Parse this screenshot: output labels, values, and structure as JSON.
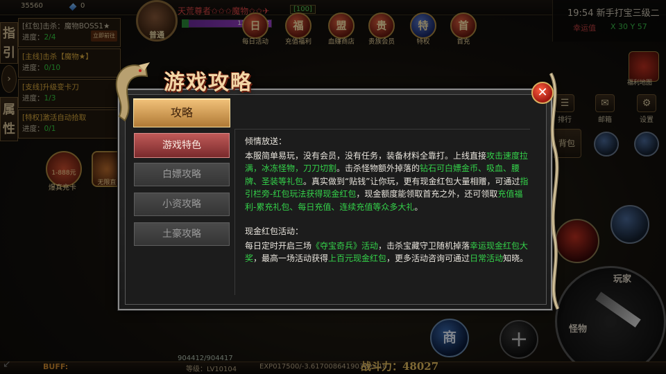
{
  "hud": {
    "gold": "35560",
    "gems": "0",
    "side_tabs": [
      "指",
      "引",
      "属",
      "性"
    ],
    "quests": [
      {
        "title": "[红包]击杀：魔物BOSS1★",
        "progress_label": "进度：",
        "progress": "2/4",
        "button": "立即前往"
      },
      {
        "title": "[主线]击杀【魔物★】",
        "progress_label": "进度：",
        "progress": "0/10"
      },
      {
        "title": "[支线]升级变卡刀",
        "progress_label": "进度：",
        "progress": "1/3"
      },
      {
        "title": "[特权]激活自动拾取",
        "progress_label": "进度：",
        "progress": "0/1"
      }
    ],
    "avatar_label": "普通",
    "player_name": "天荒尊者✩✩✩魔物✩✩✈",
    "player_level": "[100]",
    "hp_text": "12131853",
    "top_icons": [
      {
        "glyph": "日",
        "label": "每日活动"
      },
      {
        "glyph": "福",
        "label": "充值福利"
      },
      {
        "glyph": "盟",
        "label": "血赚商店"
      },
      {
        "glyph": "贵",
        "label": "贵族会员"
      },
      {
        "glyph": "特",
        "label": "特权"
      },
      {
        "glyph": "首",
        "label": "首充"
      }
    ],
    "clock": "19:54 新手打宝三级二",
    "clock_sub": "幸运值",
    "clock_coords": "X 30  Y 57",
    "right_icons": [
      {
        "glyph": "☰",
        "label": "排行"
      },
      {
        "glyph": "✉",
        "label": "邮箱"
      },
      {
        "glyph": "⚙",
        "label": "设置"
      }
    ],
    "right_extra": "福利地图",
    "bag_label": "背包",
    "left_item_1": "1-888元",
    "left_item_1_sub": "爆真充卡",
    "left_item_2": "无限直",
    "shop_label": "商",
    "plus_label": "+",
    "attack_top": "玩家",
    "attack_bottom": "怪物",
    "buff_label": "BUFF:",
    "level_text": "等级：LV10104",
    "exp_text": "EXP017500/-3.6170086419036e+18",
    "power_text": "战斗力：48027",
    "pet_hp": "904412/904417"
  },
  "dialog": {
    "title": "游戏攻略",
    "close_glyph": "✕",
    "tabs": [
      "攻略",
      "游戏特色",
      "白嫖攻略",
      "小资攻略",
      "土豪攻略"
    ],
    "section1_heading": "倾情放送：",
    "section1_parts": [
      {
        "t": "本服简单易玩，没有会员，没有任务，装备材料全靠打。上线直接",
        "h": false
      },
      {
        "t": "攻击速度拉满，冰冻怪物，刀刀切割",
        "h": true
      },
      {
        "t": "。击杀怪物额外掉落的",
        "h": false
      },
      {
        "t": "钻石可白嫖金币、吸血、腰牌、圣装等礼包",
        "h": true
      },
      {
        "t": "。真实做到“贴钱”让你玩，更有现金红包大量相赠，可通过",
        "h": false
      },
      {
        "t": "指引栏旁-红包玩法获得现金红包",
        "h": true
      },
      {
        "t": "，现金额度能领取首充之外，还可领取",
        "h": false
      },
      {
        "t": "充值福利-累充礼包、每日充值、连续充值等众多大礼",
        "h": true
      },
      {
        "t": "。",
        "h": false
      }
    ],
    "section2_heading": "现金红包活动：",
    "section2_parts": [
      {
        "t": "每日定时开启三场",
        "h": false
      },
      {
        "t": "《夺宝奇兵》活动",
        "h": true
      },
      {
        "t": "，击杀宝藏守卫随机掉落",
        "h": false
      },
      {
        "t": "幸运现金红包大奖",
        "h": true
      },
      {
        "t": "，最高一场活动获得",
        "h": false
      },
      {
        "t": "上百元现金红包",
        "h": true
      },
      {
        "t": "，更多活动咨询可通过",
        "h": false
      },
      {
        "t": "日常活动",
        "h": true
      },
      {
        "t": "知晓。",
        "h": false
      }
    ]
  }
}
